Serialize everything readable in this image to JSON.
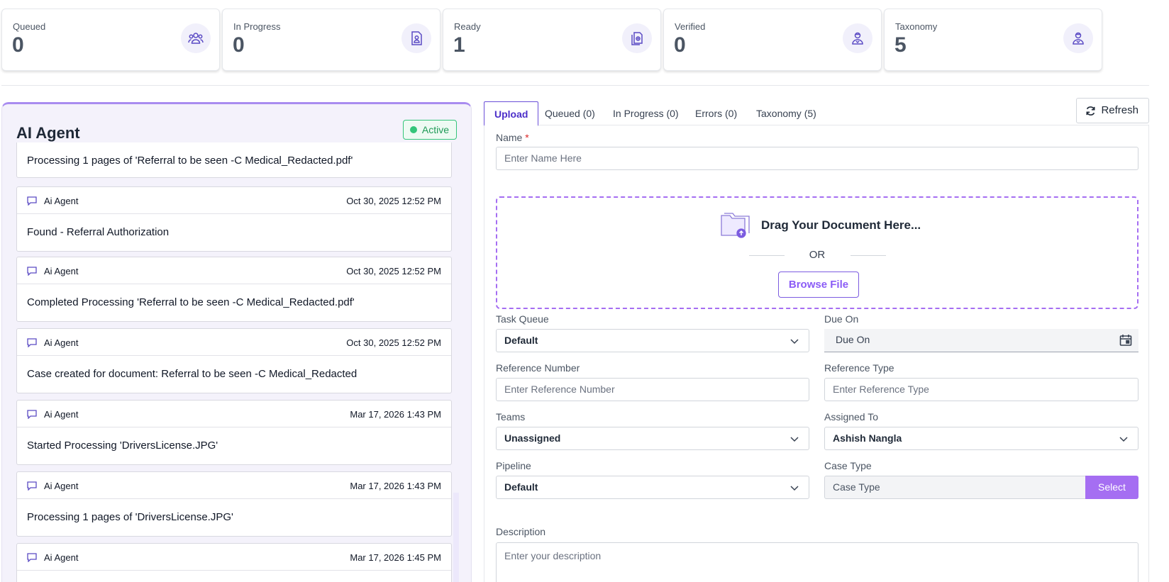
{
  "stats": [
    {
      "label": "Queued",
      "value": "0",
      "icon": "users-icon"
    },
    {
      "label": "In Progress",
      "value": "0",
      "icon": "document-user-icon"
    },
    {
      "label": "Ready",
      "value": "1",
      "icon": "documents-icon"
    },
    {
      "label": "Verified",
      "value": "0",
      "icon": "doctor-icon"
    },
    {
      "label": "Taxonomy",
      "value": "5",
      "icon": "doctor-icon"
    }
  ],
  "agent": {
    "title": "AI Agent",
    "status": "Active",
    "logs": [
      {
        "who": "",
        "when": "",
        "message": "Processing 1 pages of 'Referral to be seen -C Medical_Redacted.pdf'"
      },
      {
        "who": "Ai Agent",
        "when": "Oct 30, 2025 12:52 PM",
        "message": "Found - Referral Authorization"
      },
      {
        "who": "Ai Agent",
        "when": "Oct 30, 2025 12:52 PM",
        "message": "Completed Processing 'Referral to be seen -C Medical_Redacted.pdf'"
      },
      {
        "who": "Ai Agent",
        "when": "Oct 30, 2025 12:52 PM",
        "message": "Case created for document: Referral to be seen -C Medical_Redacted"
      },
      {
        "who": "Ai Agent",
        "when": "Mar 17, 2026 1:43 PM",
        "message": "Started Processing 'DriversLicense.JPG'"
      },
      {
        "who": "Ai Agent",
        "when": "Mar 17, 2026 1:43 PM",
        "message": "Processing 1 pages of 'DriversLicense.JPG'"
      },
      {
        "who": "Ai Agent",
        "when": "Mar 17, 2026 1:45 PM",
        "message": ""
      }
    ]
  },
  "tabs": [
    {
      "label": "Upload",
      "active": true
    },
    {
      "label": "Queued (0)"
    },
    {
      "label": "In Progress (0)"
    },
    {
      "label": "Errors (0)"
    },
    {
      "label": "Taxonomy (5)"
    }
  ],
  "refresh_label": "Refresh",
  "form": {
    "name_label": "Name",
    "name_required": "*",
    "name_placeholder": "Enter Name Here",
    "drop_title": "Drag Your Document Here...",
    "drop_or": "OR",
    "browse_label": "Browse File",
    "task_queue_label": "Task Queue",
    "task_queue_value": "Default",
    "due_on_label": "Due On",
    "due_on_placeholder": "Due On",
    "reference_number_label": "Reference Number",
    "reference_number_placeholder": "Enter Reference Number",
    "reference_type_label": "Reference Type",
    "reference_type_placeholder": "Enter Reference Type",
    "teams_label": "Teams",
    "teams_value": "Unassigned",
    "assigned_to_label": "Assigned To",
    "assigned_to_value": "Ashish Nangla",
    "pipeline_label": "Pipeline",
    "pipeline_value": "Default",
    "case_type_label": "Case Type",
    "case_type_placeholder": "Case Type",
    "select_label": "Select",
    "description_label": "Description",
    "description_placeholder": "Enter your description"
  },
  "colors": {
    "accent": "#a56ef2",
    "primary": "#4c2fc9",
    "active": "#34c57a"
  }
}
